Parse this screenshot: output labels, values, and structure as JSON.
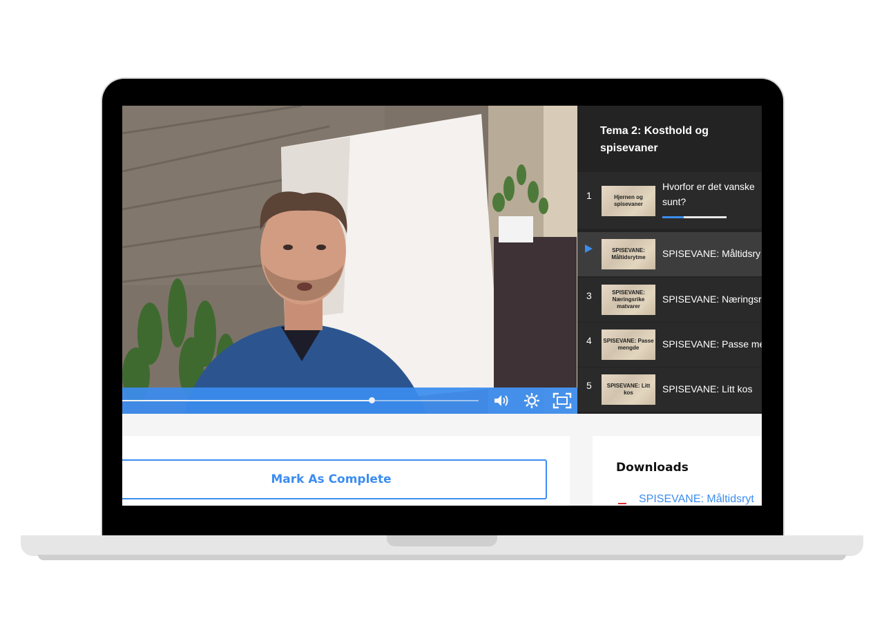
{
  "playlist": {
    "title": "Tema 2: Kosthold og spisevaner",
    "items": [
      {
        "number": "1",
        "thumb": "Hjernen og spisevaner",
        "text": "Hvorfor er det vanske",
        "text2": "sunt?",
        "progress": 0.33,
        "active": false
      },
      {
        "number": "",
        "thumb": "SPISEVANE: Måltidsrytme",
        "text": "SPISEVANE: Måltidsry",
        "active": true
      },
      {
        "number": "3",
        "thumb": "SPISEVANE: Næringsrike matvarer",
        "text": "SPISEVANE: Næringsri",
        "active": false
      },
      {
        "number": "4",
        "thumb": "SPISEVANE: Passe mengde",
        "text": "SPISEVANE: Passe me",
        "active": false
      },
      {
        "number": "5",
        "thumb": "SPISEVANE: Litt kos",
        "text": "SPISEVANE: Litt kos",
        "active": false
      }
    ]
  },
  "player": {
    "seek_progress": 0.7,
    "volume_icon": "volume-icon",
    "settings_icon": "gear-icon",
    "fullscreen_icon": "fullscreen-icon"
  },
  "lesson": {
    "mark_complete_label": "Mark As Complete"
  },
  "downloads": {
    "title": "Downloads",
    "items": [
      {
        "label": "SPISEVANE: Måltidsryt",
        "icon": "pdf-icon"
      }
    ]
  },
  "colors": {
    "accent": "#3b8df0",
    "playlist_bg": "#232323",
    "playlist_active": "#3d3d3d"
  }
}
